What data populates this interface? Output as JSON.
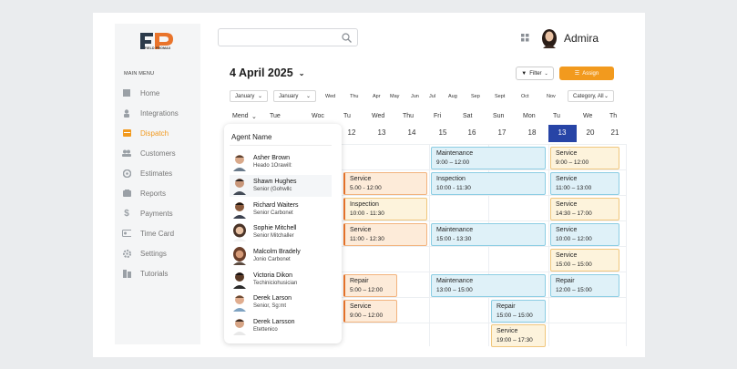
{
  "brand": {
    "logo_letters": "FP",
    "logo_text": "FIELD PROMAX"
  },
  "colors": {
    "accent": "#f29a1e",
    "today": "#2744a6",
    "service": "#e9742b",
    "maintenance": "#8ccde3"
  },
  "sidebar": {
    "title": "MAIN MENU",
    "items": [
      {
        "label": "Home",
        "icon": "home-icon"
      },
      {
        "label": "Integrations",
        "icon": "person-icon"
      },
      {
        "label": "Dispatch",
        "icon": "dispatch-icon",
        "active": true
      },
      {
        "label": "Customers",
        "icon": "customers-icon"
      },
      {
        "label": "Estimates",
        "icon": "estimates-icon"
      },
      {
        "label": "Reports",
        "icon": "reports-icon"
      },
      {
        "label": "Payments",
        "icon": "dollar-icon"
      },
      {
        "label": "Time Card",
        "icon": "time-card-icon"
      },
      {
        "label": "Settings",
        "icon": "gear-icon"
      },
      {
        "label": "Tutorials",
        "icon": "tutorials-icon"
      }
    ]
  },
  "header": {
    "search_placeholder": "",
    "user_name": "Admira"
  },
  "calendar": {
    "date_title": "4 April 2025",
    "filter_label": "Filter",
    "assign_label": "Assign",
    "select1": "January",
    "select2": "January",
    "months": [
      "Wed",
      "Thu",
      "Apr",
      "May",
      "Jun",
      "Jul",
      "Aug",
      "Sep",
      "Sept",
      "Oct",
      "Nov"
    ],
    "category": "Category, All",
    "days": [
      "Mend",
      "Tue",
      "Woc",
      "Tu",
      "Wed",
      "Thu",
      "Fri",
      "Sat",
      "Sun",
      "Mon",
      "Tu",
      "We",
      "Th"
    ],
    "dates": [
      "12",
      "13",
      "14",
      "15",
      "16",
      "17",
      "18",
      "13",
      "20",
      "21"
    ],
    "today_index": 7,
    "events": [
      {
        "title": "Maintenance",
        "time": "9:00 – 12:00"
      },
      {
        "title": "Service",
        "time": "9:00 – 12:00"
      },
      {
        "title": "Service",
        "time": "5.00 - 12:00"
      },
      {
        "title": "Inspection",
        "time": "10:00 - 11:30"
      },
      {
        "title": "Service",
        "time": "11:00 – 13:00"
      },
      {
        "title": "Inspection",
        "time": "10:00 - 11:30"
      },
      {
        "title": "Service",
        "time": "14:30 – 17:00"
      },
      {
        "title": "Service",
        "time": "11:00 - 12:30"
      },
      {
        "title": "Maintenance",
        "time": "15:00 - 13:30"
      },
      {
        "title": "Service",
        "time": "10:00 – 12:00"
      },
      {
        "title": "Service",
        "time": "15:00 – 15:00"
      },
      {
        "title": "Repair",
        "time": "5:00 – 12:00"
      },
      {
        "title": "Maintenance",
        "time": "13:00 – 15:00"
      },
      {
        "title": "Repair",
        "time": "12:00 – 15:00"
      },
      {
        "title": "Service",
        "time": "9:00 – 12:00"
      },
      {
        "title": "Repair",
        "time": "15:00 – 15:00"
      },
      {
        "title": "Service",
        "time": "19:00 – 17:30"
      }
    ]
  },
  "agents": {
    "header": "Agent Name",
    "list": [
      {
        "name": "Asher Brown",
        "role": "Heado 1Orawill:"
      },
      {
        "name": "Shawn Hughes",
        "role": "Senior (Gohwllc"
      },
      {
        "name": "Richard Waiters",
        "role": "Senior Carbonet"
      },
      {
        "name": "Sophie Mitchell",
        "role": "Senior Mitchaller"
      },
      {
        "name": "Malcolm Bradely",
        "role": "Jonio Carbonet"
      },
      {
        "name": "Victoria Dikon",
        "role": "Techiniciohusician"
      },
      {
        "name": "Derek Larson",
        "role": "Senior, Sg:mt"
      },
      {
        "name": "Derek Larsson",
        "role": "Etettenico"
      }
    ]
  }
}
